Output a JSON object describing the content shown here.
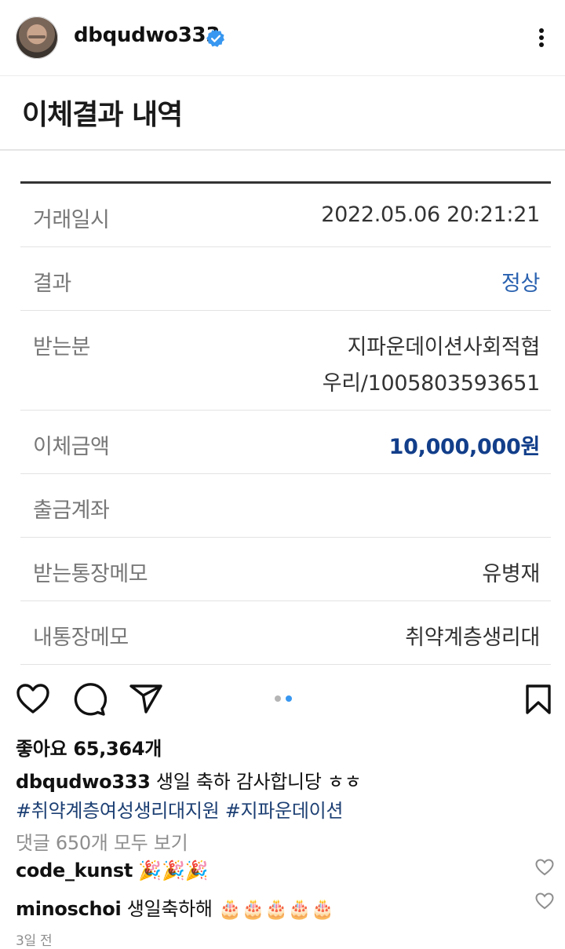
{
  "header": {
    "username": "dbqudwo333",
    "verified_icon": "verified-badge-icon",
    "more_icon": "more-vertical-icon"
  },
  "receipt": {
    "title": "이체결과 내역",
    "rows": [
      {
        "label": "거래일시",
        "value": "2022.05.06 20:21:21"
      },
      {
        "label": "결과",
        "value": "정상"
      },
      {
        "label": "받는분",
        "value_line1": "지파운데이션사회적협",
        "value_line2": "우리/1005803593651"
      },
      {
        "label": "이체금액",
        "value": "10,000,000원"
      },
      {
        "label": "출금계좌",
        "value": ""
      },
      {
        "label": "받는통장메모",
        "value": "유병재"
      },
      {
        "label": "내통장메모",
        "value": "취약계층생리대"
      }
    ]
  },
  "actions": {
    "like_icon": "heart-icon",
    "comment_icon": "comment-icon",
    "share_icon": "send-icon",
    "save_icon": "bookmark-icon",
    "carousel_pages": 2,
    "carousel_current": 2
  },
  "likes": {
    "label": "좋아요",
    "count": "65,364개"
  },
  "caption": {
    "username": "dbqudwo333",
    "text": "생일 축하 감사합니당 ㅎㅎ",
    "hashtags": "#취약계층여성생리대지원 #지파운데이션"
  },
  "view_comments": "댓글 650개 모두 보기",
  "comments": [
    {
      "username": "code_kunst",
      "text": "🎉🎉🎉"
    },
    {
      "username": "minoschoi",
      "text": "생일축하해 🎂🎂🎂🎂🎂"
    }
  ],
  "timestamp": "3일 전",
  "colors": {
    "link_blue": "#2a62b0",
    "amount_blue": "#123e8a",
    "hashtag": "#1c3f73",
    "verified": "#3897f0",
    "muted": "#8e8e8e"
  }
}
